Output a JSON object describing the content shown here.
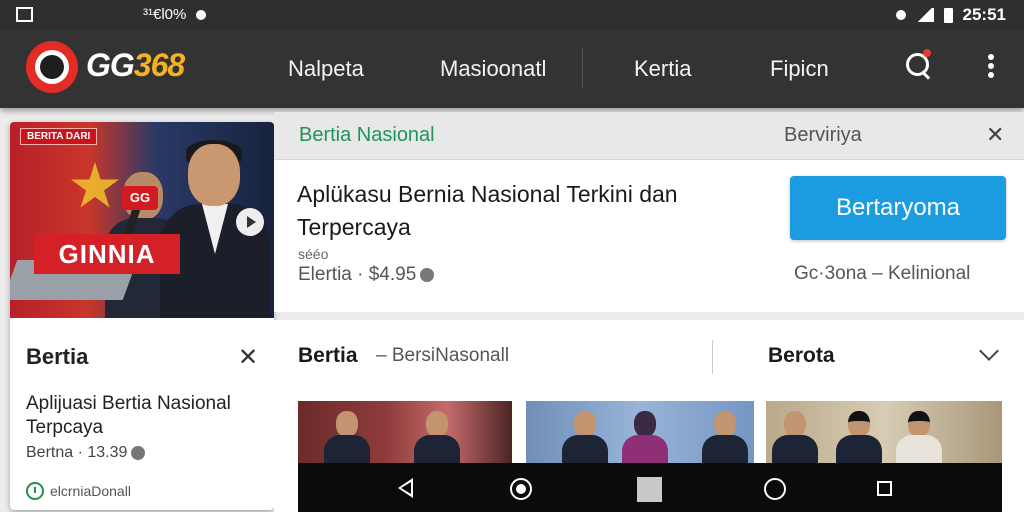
{
  "status_bar": {
    "left_text": "³¹€l0%",
    "time": "25:51"
  },
  "app_bar": {
    "brand_white": "GG",
    "brand_yellow": "368",
    "nav": [
      "Nalpeta",
      "Masioonatl",
      "Kertia",
      "Fipicn"
    ]
  },
  "left_card": {
    "photo_tag": "BERITA DARI",
    "photo_mic": "GG",
    "photo_banner": "GINNIA",
    "heading": "Bertia",
    "close": "✕",
    "title": "Aplijuasi Bertia Nasional Terpcaya",
    "meta": "Bertna · 13.39",
    "footer": "elcrniaDonall"
  },
  "tab_strip": {
    "active_tab": "Bertia Nasional",
    "secondary_tab": "Berviriya",
    "close": "✕"
  },
  "promo": {
    "title": "Aplükasu Bernia Nasional Terkini dan Terpercaya",
    "subtitle": "sééo",
    "meta": "Elertia · $4.95",
    "button": "Bertaryoma",
    "right_meta": "Gc·3ona – Kelinional"
  },
  "section": {
    "heading": "Bertia",
    "subheading": "– BersiNasonall",
    "right_heading": "Berota"
  }
}
